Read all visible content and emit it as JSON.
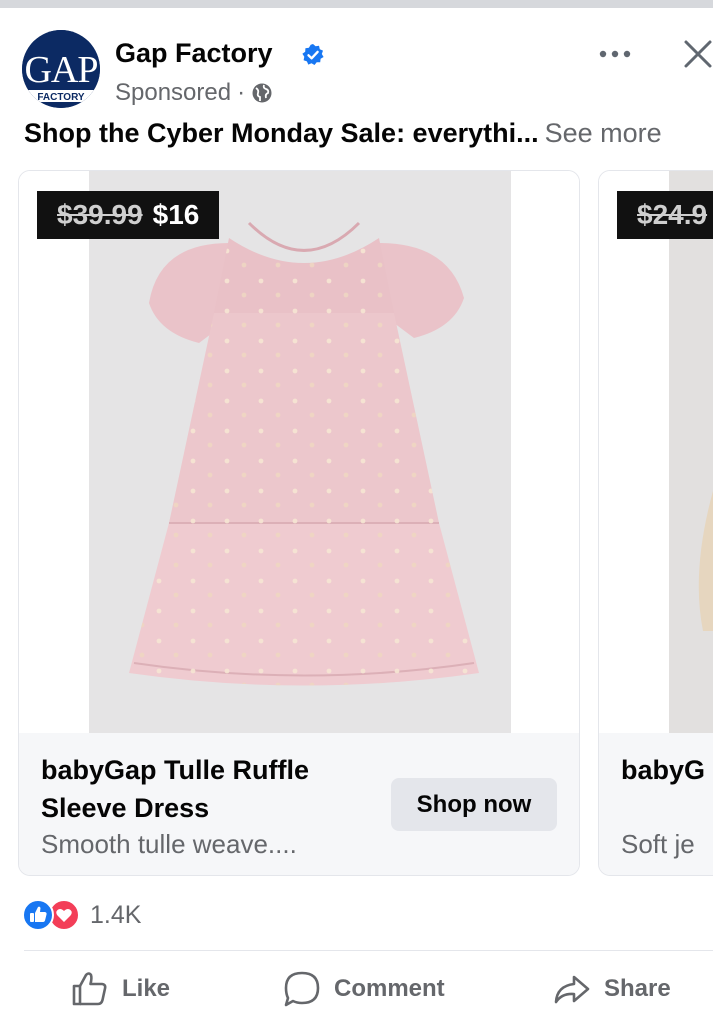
{
  "post": {
    "page_name": "Gap Factory",
    "sponsored_label": "Sponsored",
    "sponsored_separator": "·",
    "logo_text_top": "GAP",
    "logo_text_bottom": "FACTORY",
    "text": "Shop the Cyber Monday Sale: everythi...",
    "see_more": "See more"
  },
  "carousel": {
    "cards": [
      {
        "old_price": "$39.99",
        "new_price": "$16",
        "title": "babyGap Tulle Ruffle Sleeve Dress",
        "description": "Smooth tulle weave....",
        "cta": "Shop now"
      },
      {
        "old_price": "$24.9",
        "title": "babyG Story",
        "description": "Soft je"
      }
    ]
  },
  "engagement": {
    "reaction_count": "1.4K",
    "reaction_icons": [
      "like-reaction-icon",
      "love-reaction-icon"
    ]
  },
  "actions": {
    "like": "Like",
    "comment": "Comment",
    "share": "Share"
  },
  "colors": {
    "verified_blue": "#1877f2",
    "secondary_text": "#65676b",
    "love_red": "#f33e58",
    "dress_pink": "#ecc7cc"
  }
}
